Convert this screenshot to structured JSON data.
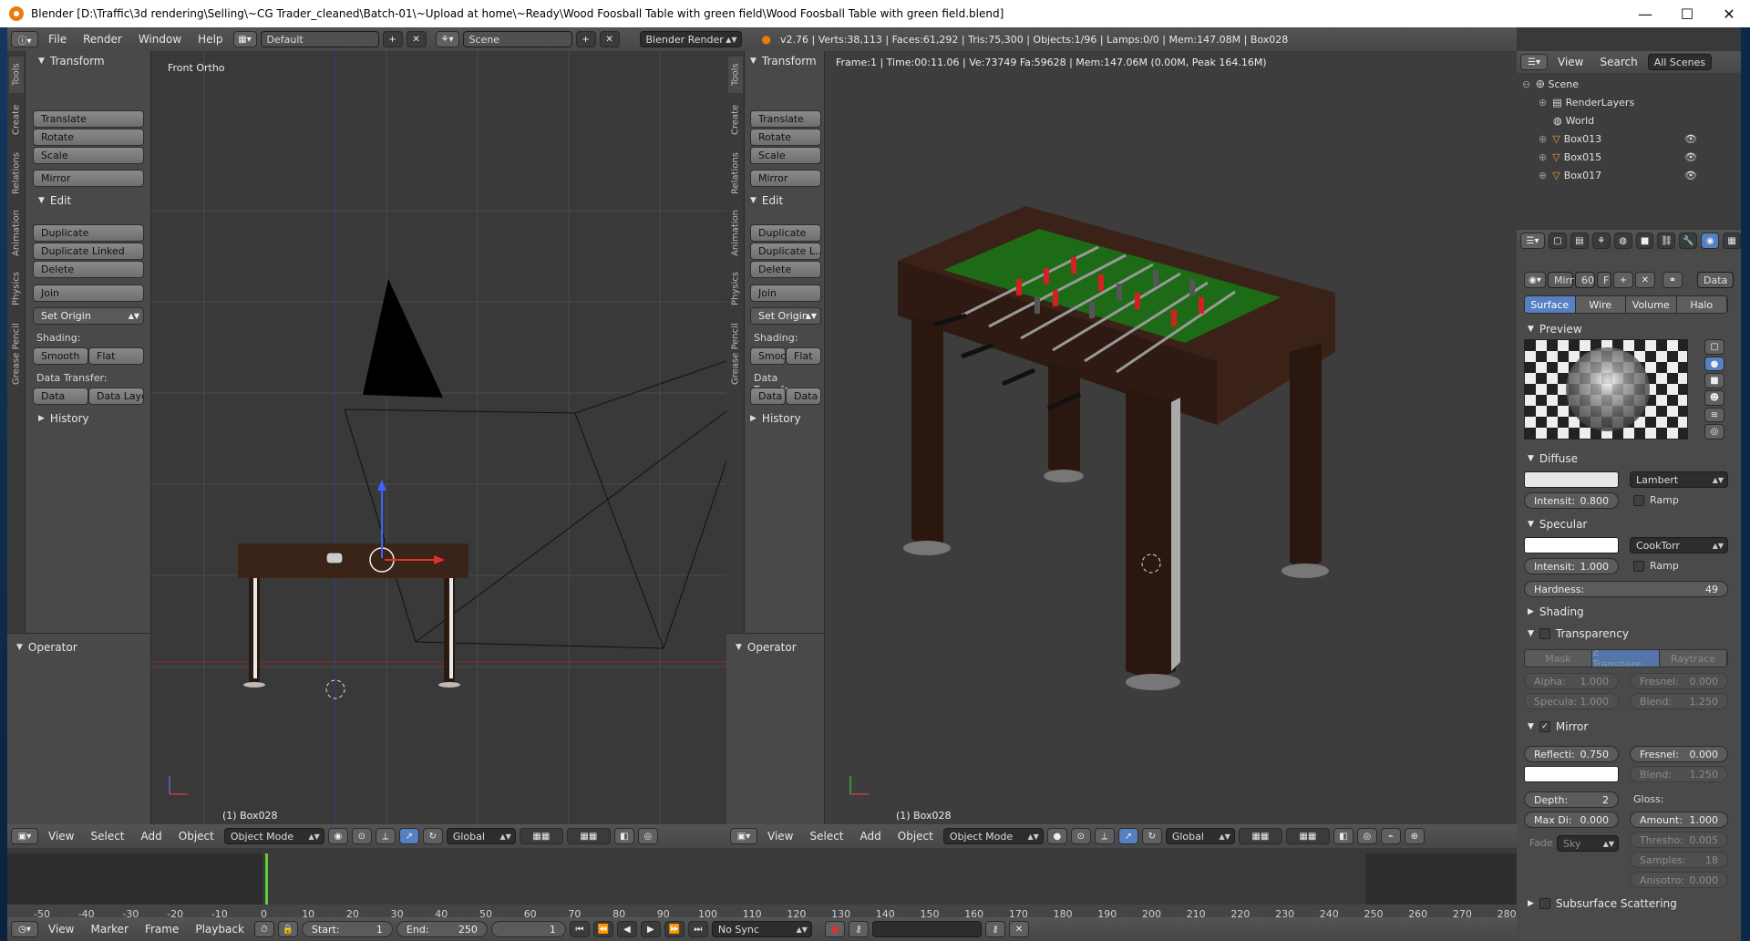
{
  "window": {
    "title": "Blender [D:\\Traffic\\3d rendering\\Selling\\~CG Trader_cleaned\\Batch-01\\~Upload at home\\~Ready\\Wood Foosball Table with green field\\Wood Foosball Table with green field.blend]",
    "minimize": "—",
    "maximize": "☐",
    "close": "✕"
  },
  "infobar": {
    "menus": [
      "File",
      "Render",
      "Window",
      "Help"
    ],
    "layout": "Default",
    "scene": "Scene",
    "engine": "Blender Render",
    "stats": "v2.76 | Verts:38,113 | Faces:61,292 | Tris:75,300 | Objects:1/96 | Lamps:0/0 | Mem:147.08M | Box028"
  },
  "left_tools": {
    "tabs": [
      "Tools",
      "Create",
      "Relations",
      "Animation",
      "Physics",
      "Grease Pencil"
    ],
    "transform_header": "Transform",
    "translate": "Translate",
    "rotate": "Rotate",
    "scale": "Scale",
    "mirror": "Mirror",
    "edit_header": "Edit",
    "duplicate": "Duplicate",
    "duplicate_linked": "Duplicate Linked",
    "delete": "Delete",
    "join": "Join",
    "set_origin": "Set Origin",
    "shading_label": "Shading:",
    "smooth": "Smooth",
    "flat": "Flat",
    "data_transfer_label": "Data Transfer:",
    "data": "Data",
    "data_layout": "Data Layo",
    "history_header": "History",
    "operator_header": "Operator"
  },
  "right_tools": {
    "transform_header": "Transform",
    "translate": "Translate",
    "rotate": "Rotate",
    "scale": "Scale",
    "mirror": "Mirror",
    "edit_header": "Edit",
    "duplicate": "Duplicate",
    "duplicate_linked": "Duplicate L...",
    "delete": "Delete",
    "join": "Join",
    "set_origin": "Set Origin",
    "shading_label": "Shading:",
    "smooth": "Smoo",
    "flat": "Flat",
    "data_transfer_label": "Data Transfer:",
    "data": "Data",
    "data2": "Data",
    "history_header": "History",
    "operator_header": "Operator"
  },
  "left_view": {
    "label": "Front Ortho",
    "object": "(1) Box028"
  },
  "right_view": {
    "render_info": "Frame:1 | Time:00:11.06 | Ve:73749 Fa:59628 | Mem:147.06M (0.00M, Peak 164.16M)",
    "object": "(1) Box028"
  },
  "view_header": {
    "menus": [
      "View",
      "Select",
      "Add",
      "Object"
    ],
    "mode": "Object Mode",
    "orientation": "Global"
  },
  "outliner": {
    "menus": [
      "View",
      "Search"
    ],
    "filter": "All Scenes",
    "rows": [
      "Scene",
      "RenderLayers",
      "World",
      "Box013",
      "Box015",
      "Box017"
    ]
  },
  "properties": {
    "material_name": "Mirr",
    "users": "60",
    "fake": "F",
    "data_btn": "Data",
    "tabs": [
      "Surface",
      "Wire",
      "Volume",
      "Halo"
    ],
    "preview_header": "Preview",
    "diffuse_header": "Diffuse",
    "diffuse_shader": "Lambert",
    "diffuse_intensity_label": "Intensit:",
    "diffuse_intensity": "0.800",
    "ramp": "Ramp",
    "specular_header": "Specular",
    "specular_shader": "CookTorr",
    "specular_intensity_label": "Intensit:",
    "specular_intensity": "1.000",
    "hardness_label": "Hardness:",
    "hardness": "49",
    "shading_header": "Shading",
    "transparency_header": "Transparency",
    "transp_modes": [
      "Mask",
      "Z Transpare...",
      "Raytrace"
    ],
    "alpha_label": "Alpha:",
    "alpha": "1.000",
    "fresnel_label": "Fresnel:",
    "fresnel": "0.000",
    "specula_label": "Specula:",
    "specula": "1.000",
    "blend_label": "Blend:",
    "blend": "1.250",
    "mirror_header": "Mirror",
    "reflect_label": "Reflecti:",
    "reflect": "0.750",
    "m_fresnel_label": "Fresnel:",
    "m_fresnel": "0.000",
    "m_blend_label": "Blend:",
    "m_blend": "1.250",
    "depth_label": "Depth:",
    "depth": "2",
    "maxdist_label": "Max Di:",
    "maxdist": "0.000",
    "gloss_label": "Gloss:",
    "amount_label": "Amount:",
    "amount": "1.000",
    "thresh_label": "Thresho:",
    "thresh": "0.005",
    "samples_label": "Samples:",
    "samples": "18",
    "aniso_label": "Anisotro:",
    "aniso": "0.000",
    "fade_label": "Fade",
    "fade": "Sky",
    "sss_header": "Subsurface Scattering"
  },
  "timeline": {
    "ticks": [
      "-50",
      "-40",
      "-30",
      "-20",
      "-10",
      "0",
      "10",
      "20",
      "30",
      "40",
      "50",
      "60",
      "70",
      "80",
      "90",
      "100",
      "110",
      "120",
      "130",
      "140",
      "150",
      "160",
      "170",
      "180",
      "190",
      "200",
      "210",
      "220",
      "230",
      "240",
      "250",
      "260",
      "270",
      "280"
    ],
    "menus": [
      "View",
      "Marker",
      "Frame",
      "Playback"
    ],
    "start_label": "Start:",
    "start": "1",
    "end_label": "End:",
    "end": "250",
    "current": "1",
    "sync": "No Sync"
  },
  "colors": {
    "accent": "#5680c2",
    "bg": "#393939",
    "panel": "#494949"
  }
}
